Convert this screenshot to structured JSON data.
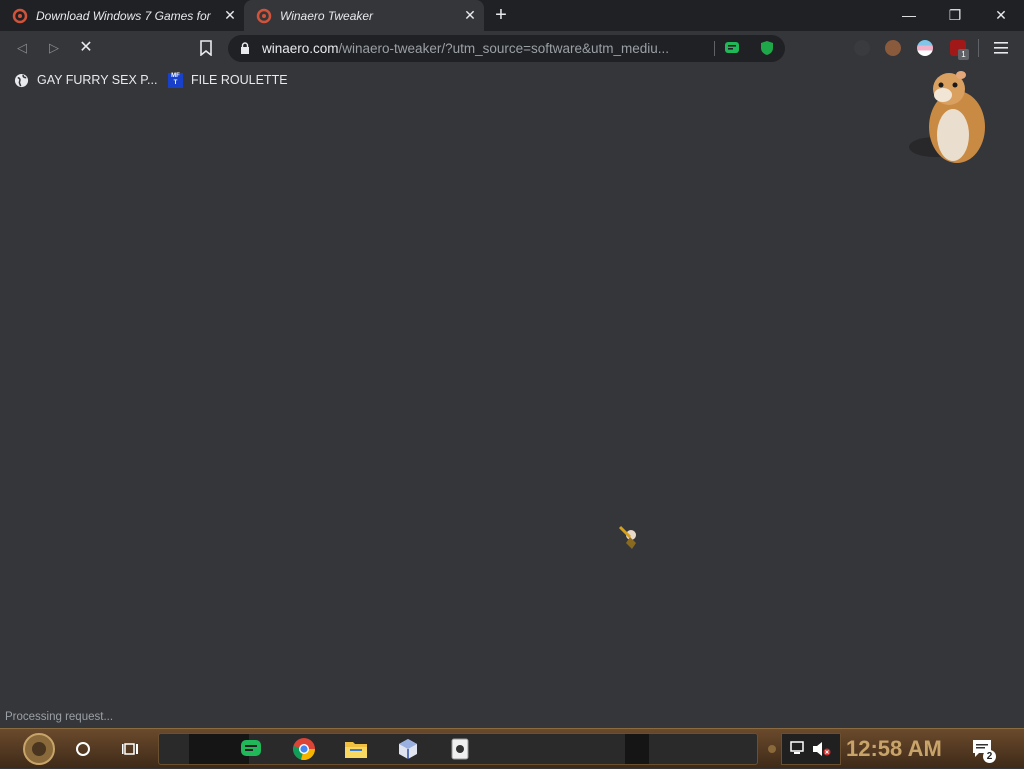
{
  "tabs": [
    {
      "title": "Download Windows 7 Games for",
      "close": "✕"
    },
    {
      "title": "Winaero Tweaker",
      "close": "✕"
    }
  ],
  "new_tab": "+",
  "window_controls": {
    "minimize": "—",
    "restore": "❐",
    "close": "✕"
  },
  "toolbar": {
    "back": "◁",
    "forward": "▷",
    "stop": "✕",
    "url_host": "winaero.com",
    "url_path": "/winaero-tweaker/?utm_source=software&utm_mediu..."
  },
  "bookmarks": [
    {
      "label": "GAY FURRY SEX P...",
      "icon": "globe-icon"
    },
    {
      "label": "FILE ROULETTE",
      "icon": "mfr-icon"
    }
  ],
  "bookmark_icon_text": "MF\nT",
  "extension_badge": "1",
  "status_text": "Processing request...",
  "taskbar": {
    "clock": "12:58 AM",
    "notification_count": "2"
  },
  "colors": {
    "bg": "#35363a",
    "titlebar": "#202124",
    "accent_green": "#20b858",
    "clock": "#c8a46a"
  }
}
